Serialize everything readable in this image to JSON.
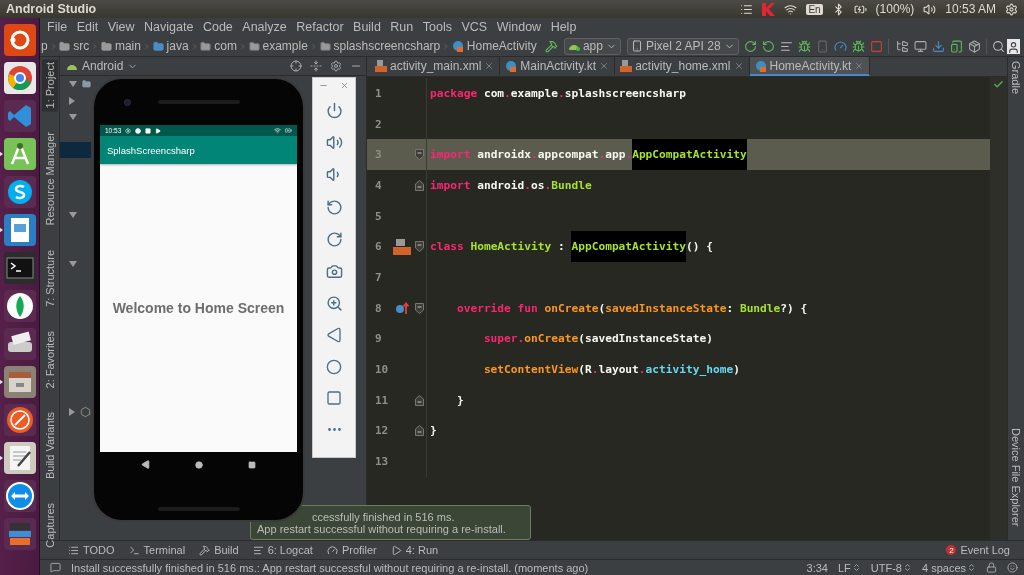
{
  "top_bar": {
    "title": "Android Studio",
    "keyboard": "En",
    "battery": "(100%)",
    "clock": "10:53 AM"
  },
  "launcher": [
    {
      "kind": "ubuntu",
      "running": false
    },
    {
      "kind": "chrome",
      "running": false
    },
    {
      "kind": "vscode",
      "running": false
    },
    {
      "kind": "android-studio",
      "running": true
    },
    {
      "kind": "skype",
      "running": false
    },
    {
      "kind": "impress",
      "running": true
    },
    {
      "kind": "terminal",
      "running": false
    },
    {
      "kind": "mongodb",
      "running": false
    },
    {
      "kind": "scanner",
      "running": false
    },
    {
      "kind": "files",
      "running": true
    },
    {
      "kind": "postman",
      "running": false
    },
    {
      "kind": "editor",
      "running": true
    },
    {
      "kind": "teamviewer",
      "running": false
    },
    {
      "kind": "stack",
      "running": false
    }
  ],
  "menu": [
    "File",
    "Edit",
    "View",
    "Navigate",
    "Code",
    "Analyze",
    "Refactor",
    "Build",
    "Run",
    "Tools",
    "VCS",
    "Window",
    "Help"
  ],
  "breadcrumb": [
    {
      "label": "p",
      "kind": "module"
    },
    {
      "label": "src",
      "kind": "folder"
    },
    {
      "label": "main",
      "kind": "folder"
    },
    {
      "label": "java",
      "kind": "source"
    },
    {
      "label": "com",
      "kind": "package"
    },
    {
      "label": "example",
      "kind": "package"
    },
    {
      "label": "splashscreencsharp",
      "kind": "package"
    },
    {
      "label": "HomeActivity",
      "kind": "class"
    }
  ],
  "toolbar": {
    "config": "app",
    "device": "Pixel 2 API 28"
  },
  "side_tabs": [
    {
      "label": "1: Project",
      "selected": true
    },
    {
      "label": "Resource Manager",
      "selected": false
    },
    {
      "label": "7: Structure",
      "selected": false
    },
    {
      "label": "2: Favorites",
      "selected": false
    },
    {
      "label": "Build Variants",
      "selected": false
    },
    {
      "label": "Captures",
      "selected": false
    }
  ],
  "project_panel": {
    "view": "Android",
    "tree": [
      {
        "kind": "folder",
        "expanded": true,
        "selected": false
      },
      {
        "kind": "folder",
        "expanded": false,
        "selected": false
      },
      {
        "kind": "folder",
        "expanded": true,
        "selected": false
      },
      {
        "kind": "file",
        "selected": false
      },
      {
        "kind": "file",
        "selected": true
      },
      {
        "kind": "file",
        "selected": false
      },
      {
        "kind": "file",
        "selected": false
      },
      {
        "kind": "file",
        "selected": false
      },
      {
        "kind": "folder",
        "expanded": true,
        "selected": false
      },
      {
        "kind": "file",
        "selected": false
      },
      {
        "kind": "file",
        "selected": false
      },
      {
        "kind": "folder",
        "expanded": true,
        "selected": false
      },
      {
        "kind": "file",
        "selected": false
      },
      {
        "kind": "file",
        "selected": false
      },
      {
        "kind": "file",
        "selected": false
      },
      {
        "kind": "file",
        "selected": false
      },
      {
        "kind": "file",
        "selected": false
      },
      {
        "kind": "file",
        "selected": false
      },
      {
        "kind": "file",
        "selected": false
      },
      {
        "kind": "file",
        "selected": false
      },
      {
        "kind": "gradle",
        "expanded": false,
        "selected": false
      }
    ]
  },
  "editor_tabs": [
    {
      "label": "activity_main.xml",
      "kind": "layout",
      "selected": false
    },
    {
      "label": "MainActivity.kt",
      "kind": "kotlin",
      "selected": false
    },
    {
      "label": "activity_home.xml",
      "kind": "layout",
      "selected": false
    },
    {
      "label": "HomeActivity.kt",
      "kind": "kotlin",
      "selected": true
    }
  ],
  "lines": [
    {
      "number": "1",
      "current": false,
      "tokens": [
        {
          "t": "package",
          "kind": "keyword"
        },
        {
          "t": " com",
          "kind": "plain"
        },
        {
          "t": ".",
          "kind": "dot"
        },
        {
          "t": "example",
          "kind": "plain"
        },
        {
          "t": ".",
          "kind": "dot"
        },
        {
          "t": "splashscreencsharp",
          "kind": "plain"
        }
      ]
    },
    {
      "number": "2",
      "current": false
    },
    {
      "number": "3",
      "current": true,
      "markers": [
        {
          "kind": "fold-start"
        }
      ],
      "tokens": [
        {
          "t": "import",
          "kind": "keyword"
        },
        {
          "t": " androidx",
          "kind": "plain"
        },
        {
          "t": ".",
          "kind": "dot"
        },
        {
          "t": "appcompat",
          "kind": "plain"
        },
        {
          "t": ".",
          "kind": "dot"
        },
        {
          "t": "app",
          "kind": "plain"
        },
        {
          "t": ".",
          "kind": "dot"
        },
        {
          "t": "AppCompatActivity",
          "kind": "type",
          "highlight": true
        }
      ]
    },
    {
      "number": "4",
      "current": false,
      "markers": [
        {
          "kind": "fold-end"
        }
      ],
      "tokens": [
        {
          "t": "import",
          "kind": "keyword"
        },
        {
          "t": " android",
          "kind": "plain"
        },
        {
          "t": ".",
          "kind": "dot"
        },
        {
          "t": "os",
          "kind": "plain"
        },
        {
          "t": ".",
          "kind": "dot"
        },
        {
          "t": "Bundle",
          "kind": "type"
        }
      ]
    },
    {
      "number": "5",
      "current": false
    },
    {
      "number": "6",
      "current": false,
      "markers": [
        {
          "kind": "layout"
        },
        {
          "kind": "fold-start"
        }
      ],
      "tokens": [
        {
          "t": "class",
          "kind": "keyword"
        },
        {
          "t": " HomeActivity",
          "kind": "type"
        },
        {
          "t": " : ",
          "kind": "plain"
        },
        {
          "t": "AppCompatActivity",
          "kind": "type",
          "highlight": true
        },
        {
          "t": "() {",
          "kind": "plain"
        }
      ]
    },
    {
      "number": "7",
      "current": false
    },
    {
      "number": "8",
      "current": false,
      "markers": [
        {
          "kind": "override"
        },
        {
          "kind": "fold-start"
        }
      ],
      "tokens": [
        {
          "t": "    override",
          "kind": "keyword"
        },
        {
          "t": " fun",
          "kind": "keyword"
        },
        {
          "t": " onCreate",
          "kind": "function"
        },
        {
          "t": "(",
          "kind": "plain"
        },
        {
          "t": "savedInstanceState",
          "kind": "function"
        },
        {
          "t": ": ",
          "kind": "plain"
        },
        {
          "t": "Bundle",
          "kind": "type"
        },
        {
          "t": "?) {",
          "kind": "plain"
        }
      ]
    },
    {
      "number": "9",
      "current": false,
      "tokens": [
        {
          "t": "        super",
          "kind": "keyword"
        },
        {
          "t": ".",
          "kind": "dot"
        },
        {
          "t": "onCreate",
          "kind": "function"
        },
        {
          "t": "(savedInstanceState)",
          "kind": "plain"
        }
      ]
    },
    {
      "number": "10",
      "current": false,
      "tokens": [
        {
          "t": "        setContentView",
          "kind": "function"
        },
        {
          "t": "(R",
          "kind": "plain"
        },
        {
          "t": ".",
          "kind": "dot"
        },
        {
          "t": "layout",
          "kind": "plain"
        },
        {
          "t": ".",
          "kind": "dot"
        },
        {
          "t": "activity_home",
          "kind": "constant"
        },
        {
          "t": ")",
          "kind": "plain"
        }
      ]
    },
    {
      "number": "11",
      "current": false,
      "markers": [
        {
          "kind": "fold-end"
        }
      ],
      "tokens": [
        {
          "t": "    }",
          "kind": "plain"
        }
      ]
    },
    {
      "number": "12",
      "current": false,
      "markers": [
        {
          "kind": "fold-end"
        }
      ],
      "tokens": [
        {
          "t": "}",
          "kind": "plain"
        }
      ]
    },
    {
      "number": "13",
      "current": false
    }
  ],
  "right_tabs": [
    "Gradle",
    "Device File Explorer"
  ],
  "emulator": {
    "status_time": "10:53",
    "app_title": "SplashScreencsharp",
    "message": "Welcome to Home Screen"
  },
  "notification": [
    "ccessfully finished in 516 ms.",
    "App restart successful without requiring a re-install."
  ],
  "tool_windows": [
    {
      "label": "TODO",
      "kind": "todo"
    },
    {
      "label": "Terminal",
      "kind": "terminal"
    },
    {
      "label": "Build",
      "kind": "build"
    },
    {
      "label": "6: Logcat",
      "kind": "logcat"
    },
    {
      "label": "Profiler",
      "kind": "profiler"
    },
    {
      "label": "4: Run",
      "kind": "run"
    }
  ],
  "event_log": {
    "label": "Event Log",
    "count": "2"
  },
  "status_bar": {
    "message": "Install successfully finished in 516 ms.: App restart successful without requiring a re-install. (moments ago)",
    "position": "3:34",
    "line_ending": "LF",
    "encoding": "UTF-8",
    "indent": "4 spaces"
  }
}
